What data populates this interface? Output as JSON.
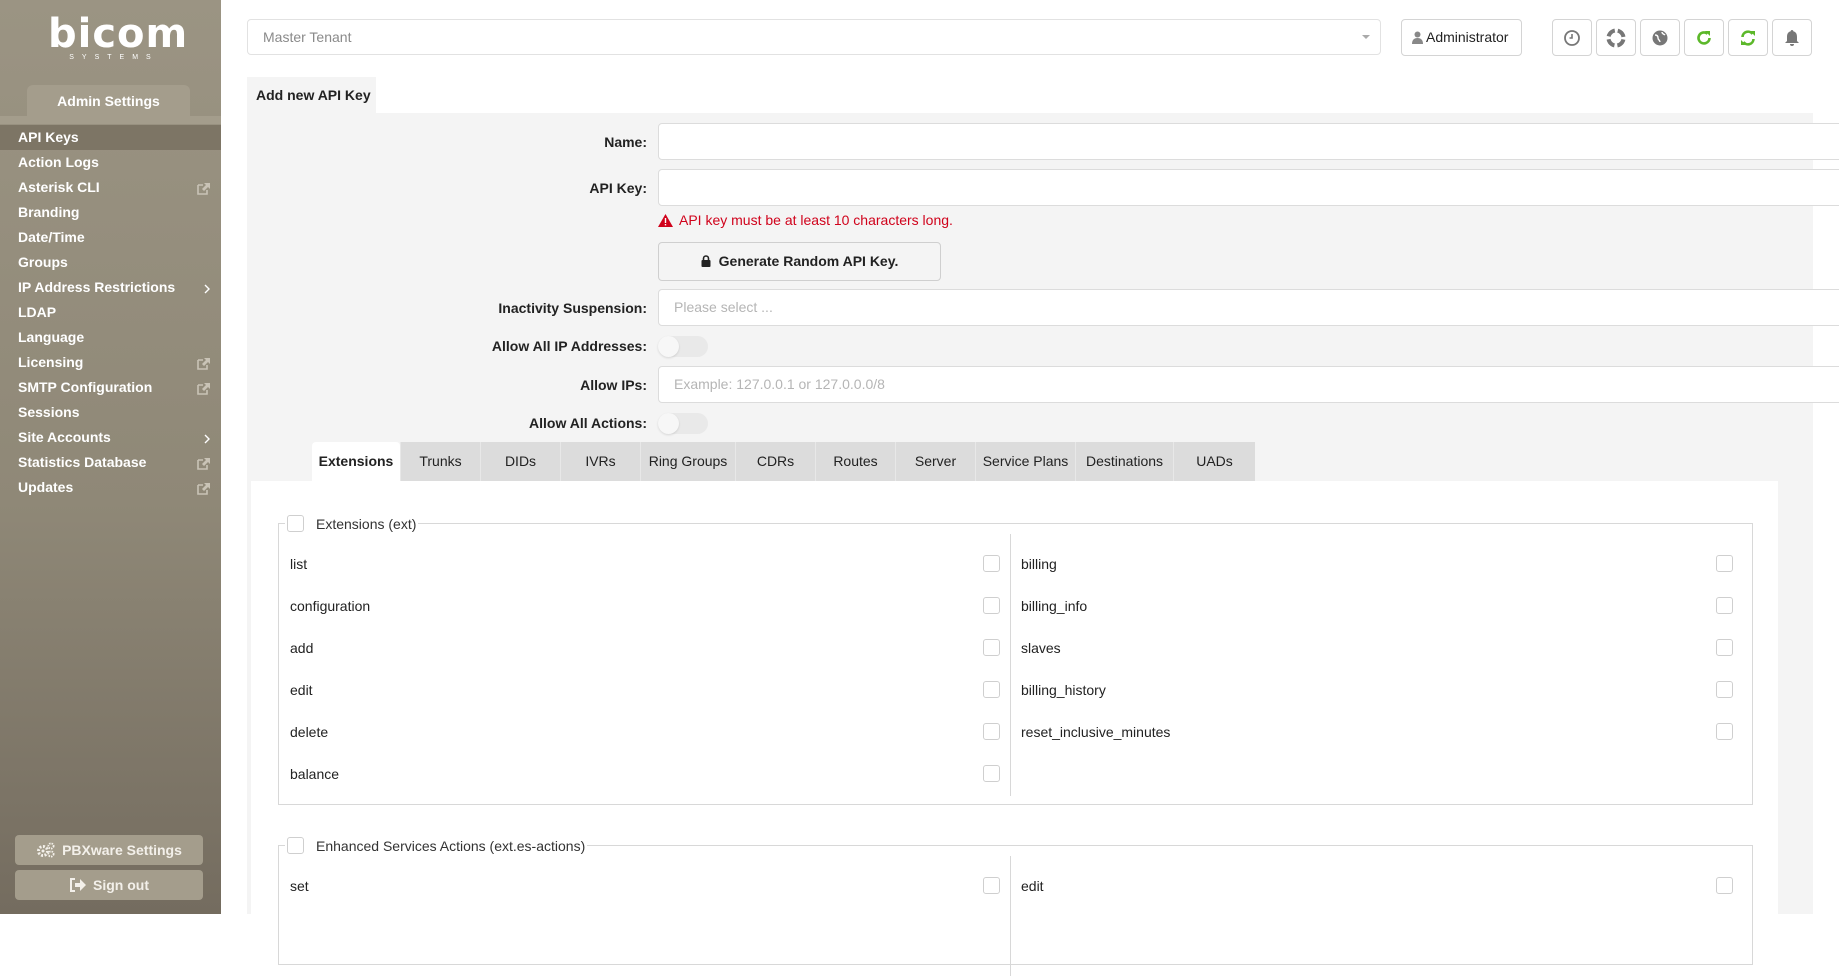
{
  "brand": {
    "name": "bicom",
    "subtitle": "SYSTEMS"
  },
  "sidebar": {
    "section_title": "Admin Settings",
    "items": [
      {
        "label": "API Keys",
        "active": true,
        "suffix": ""
      },
      {
        "label": "Action Logs",
        "suffix": ""
      },
      {
        "label": "Asterisk CLI",
        "suffix": "external-link-icon"
      },
      {
        "label": "Branding",
        "suffix": ""
      },
      {
        "label": "Date/Time",
        "suffix": ""
      },
      {
        "label": "Groups",
        "suffix": ""
      },
      {
        "label": "IP Address Restrictions",
        "suffix": "chevron-right-icon"
      },
      {
        "label": "LDAP",
        "suffix": ""
      },
      {
        "label": "Language",
        "suffix": ""
      },
      {
        "label": "Licensing",
        "suffix": "external-link-icon"
      },
      {
        "label": "SMTP Configuration",
        "suffix": "external-link-icon"
      },
      {
        "label": "Sessions",
        "suffix": ""
      },
      {
        "label": "Site Accounts",
        "suffix": "chevron-right-icon"
      },
      {
        "label": "Statistics Database",
        "suffix": "external-link-icon"
      },
      {
        "label": "Updates",
        "suffix": "external-link-icon"
      }
    ],
    "pbxware_settings_label": "PBXware Settings",
    "sign_out_label": "Sign out"
  },
  "topbar": {
    "tenant_selected": "Master Tenant",
    "user_label": "Administrator",
    "icons": [
      "clock-icon",
      "lifebuoy-icon",
      "globe-icon",
      "reload-icon",
      "sync-icon",
      "bell-icon"
    ],
    "accent_green": "#5cb82a"
  },
  "form": {
    "panel_title": "Add new API Key",
    "name_label": "Name:",
    "name_value": "",
    "api_key_label": "API Key:",
    "api_key_value": "",
    "api_key_error": "API key must be at least 10 characters long.",
    "error_color": "#d0021b",
    "generate_label": "Generate Random API Key.",
    "inactivity_label": "Inactivity Suspension:",
    "inactivity_placeholder": "Please select ...",
    "allow_all_ip_label": "Allow All IP Addresses:",
    "allow_all_ip_on": false,
    "allow_ips_label": "Allow IPs:",
    "allow_ips_placeholder": "Example: 127.0.0.1 or 127.0.0.0/8",
    "allow_all_actions_label": "Allow All Actions:",
    "allow_all_actions_on": false
  },
  "tabs": [
    {
      "label": "Extensions",
      "active": true
    },
    {
      "label": "Trunks"
    },
    {
      "label": "DIDs"
    },
    {
      "label": "IVRs"
    },
    {
      "label": "Ring Groups"
    },
    {
      "label": "CDRs"
    },
    {
      "label": "Routes"
    },
    {
      "label": "Server"
    },
    {
      "label": "Service Plans"
    },
    {
      "label": "Destinations"
    },
    {
      "label": "UADs"
    }
  ],
  "permission_groups": [
    {
      "title": "Extensions (ext)",
      "left": [
        "list",
        "configuration",
        "add",
        "edit",
        "delete",
        "balance"
      ],
      "right": [
        "billing",
        "billing_info",
        "slaves",
        "billing_history",
        "reset_inclusive_minutes"
      ]
    },
    {
      "title": "Enhanced Services Actions (ext.es-actions)",
      "left": [
        "set"
      ],
      "right": [
        "edit"
      ]
    }
  ]
}
